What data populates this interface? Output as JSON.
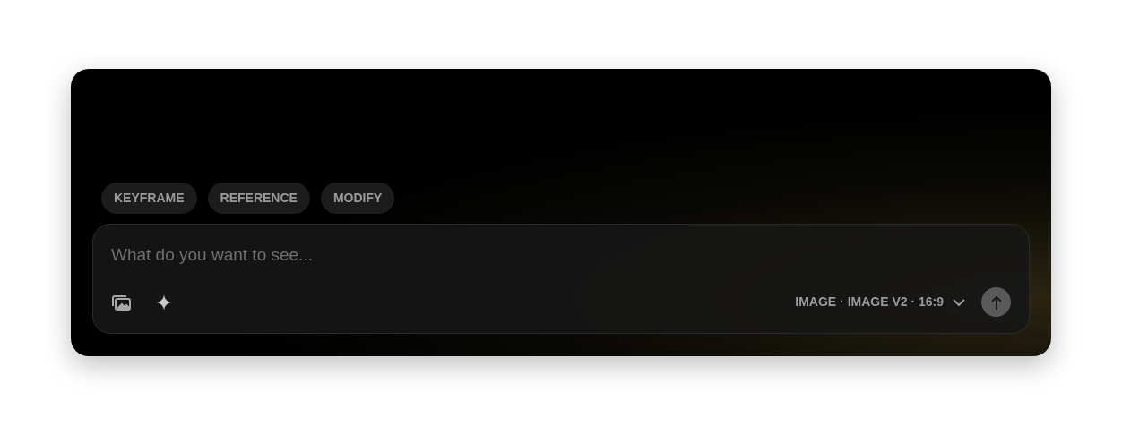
{
  "chips": [
    {
      "label": "KEYFRAME"
    },
    {
      "label": "REFERENCE"
    },
    {
      "label": "MODIFY"
    }
  ],
  "prompt": {
    "placeholder": "What do you want to see..."
  },
  "model_selector": {
    "label": "IMAGE · IMAGE V2 · 16:9"
  }
}
